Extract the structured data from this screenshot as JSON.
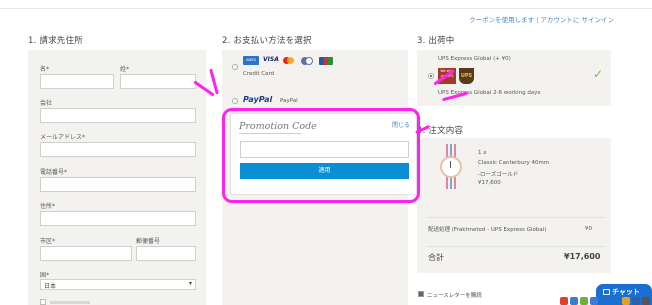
{
  "header": {
    "coupon_link": "クーポンを使用します",
    "separator": "|",
    "account_link": "アカウントに",
    "signin_link": "サインイン"
  },
  "billing": {
    "title": "1. 請求先住所",
    "first_name_label": "名*",
    "last_name_label": "姓*",
    "company_label": "会社",
    "email_label": "メールアドレス*",
    "phone_label": "電話番号*",
    "address_label": "住所*",
    "city_label": "市区*",
    "zip_label": "郵便番号",
    "country_label": "国*",
    "country_value": "日本",
    "country_chevron": "▾"
  },
  "payment": {
    "title": "2. お支払い方法を選択",
    "card_brands": [
      {
        "name": "amex",
        "text": "AMEX",
        "color": "#2b73c6"
      },
      {
        "name": "visa",
        "text": "VISA",
        "color": "#1a1f71"
      },
      {
        "name": "mastercard",
        "text": "",
        "color": "#eb7a1d"
      },
      {
        "name": "diners",
        "text": "",
        "color": "#5c6fa8"
      },
      {
        "name": "jcb",
        "text": "",
        "color": "#c0392b"
      }
    ],
    "credit_card_label": "Credit Card",
    "paypal_logo": "PayPal",
    "paypal_label": "PayPal",
    "promo_title": "Promotion Code",
    "promo_close": "閉じる",
    "promo_input_value": "",
    "apply_button": "適用"
  },
  "shipping": {
    "title": "3. 出荷中",
    "option_name": "UPS Express Global (+ ¥0)",
    "option_desc": "UPS Express Global 2-6 working days",
    "badge_wedo": "We ship via UPS",
    "badge_ups": "UPS",
    "check": "✓"
  },
  "order": {
    "title": "4. 注文内容",
    "qty": "1 x",
    "product_name_1": "Classic Canterbury 40mm",
    "product_name_2": "-ローズゴールド",
    "product_price": "¥17,600",
    "shipping_label": "配送処理 (Fraktmetod - UPS Express Global)",
    "shipping_value": "¥0",
    "total_label": "合計",
    "total_value": "¥17,600",
    "newsletter_label": "ニュースレターを購読"
  },
  "chat": {
    "label": "チャット"
  },
  "colors": {
    "highlight": "#ff22ee",
    "accent": "#0a8ed4",
    "panel": "#f3f2ee"
  }
}
